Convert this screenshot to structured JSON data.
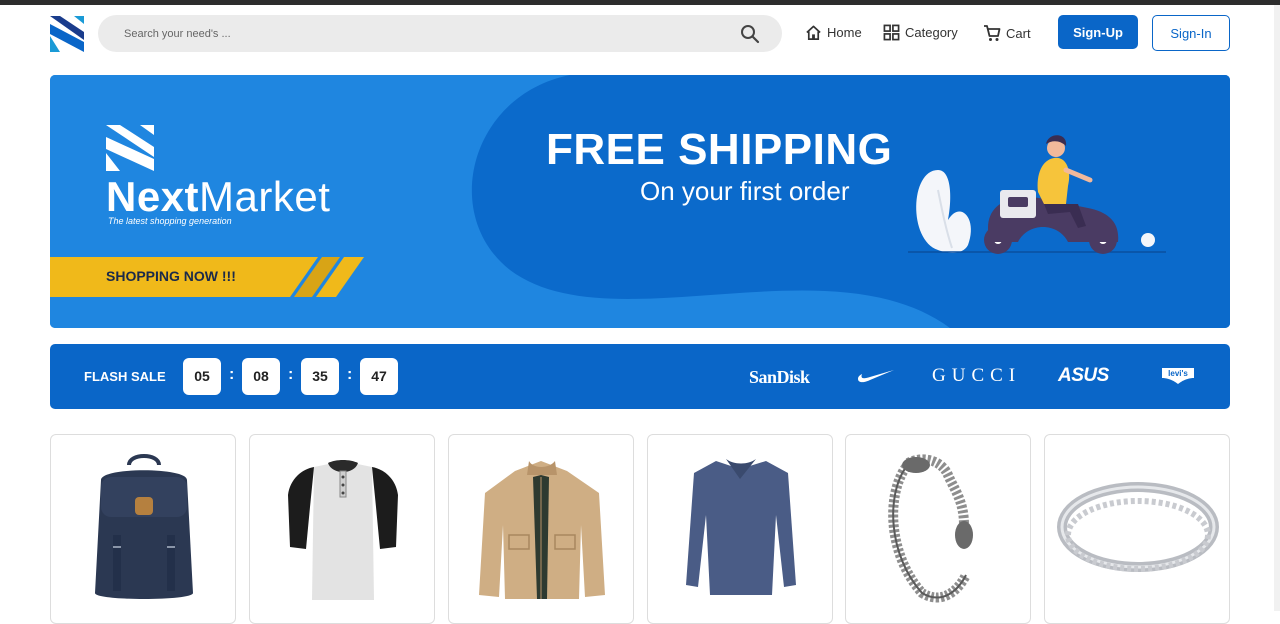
{
  "header": {
    "logo": "nextmarket-logo",
    "search": {
      "placeholder": "Search your need's ...",
      "icon": "search-icon"
    },
    "nav": [
      {
        "label": "Home",
        "icon": "home-icon"
      },
      {
        "label": "Category",
        "icon": "grid-icon"
      },
      {
        "label": "Cart",
        "icon": "cart-icon"
      }
    ],
    "signup_label": "Sign-Up",
    "signin_label": "Sign-In"
  },
  "banner": {
    "brand_name_bold": "Next",
    "brand_name_light": "Market",
    "tagline": "The latest shopping generation",
    "cta": "SHOPPING NOW !!!",
    "title": "FREE SHIPPING",
    "subtitle": "On your first order"
  },
  "flash_sale": {
    "label": "FLASH SALE",
    "timer": [
      "05",
      "08",
      "35",
      "47"
    ],
    "separator": ":",
    "brands": [
      "SanDisk",
      "nike-logo",
      "GUCCI",
      "ASUS",
      "levi's"
    ]
  },
  "products": [
    {
      "icon": "backpack-image"
    },
    {
      "icon": "raglan-shirt-image"
    },
    {
      "icon": "jacket-image"
    },
    {
      "icon": "sweater-image"
    },
    {
      "icon": "bracelet-image"
    },
    {
      "icon": "ring-image"
    }
  ],
  "colors": {
    "primary": "#0a66c8",
    "banner_blue": "#1f86e0",
    "banner_dark": "#0b6acb",
    "cta_yellow": "#f0b91a"
  }
}
